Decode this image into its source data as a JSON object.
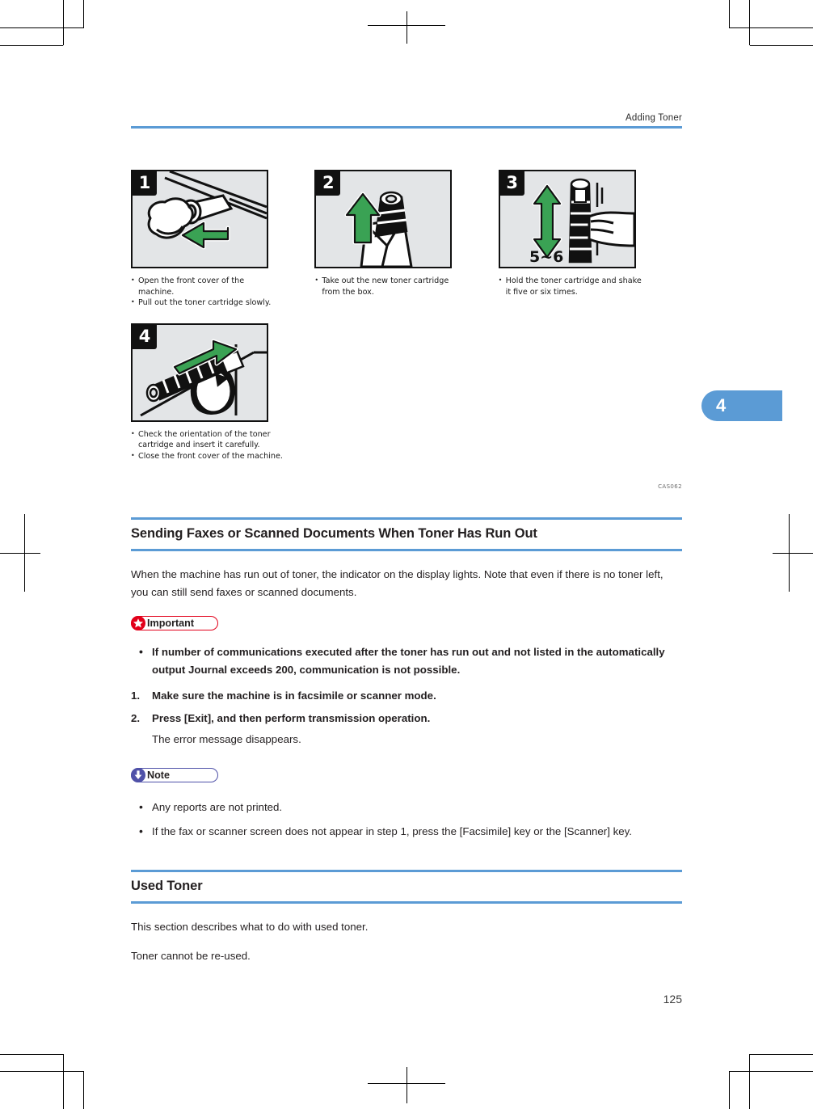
{
  "header": {
    "running_head": "Adding Toner",
    "rule_color": "#5b9bd5"
  },
  "chapter_tab": {
    "number": "4",
    "color": "#5b9bd5"
  },
  "figure": {
    "id_label": "CAS062",
    "steps": [
      {
        "number": "1",
        "alt": "hand pulling toner cartridge out of the machine",
        "captions": [
          "Open the front cover of the machine.",
          "Pull out the toner cartridge slowly."
        ]
      },
      {
        "number": "2",
        "alt": "new toner cartridge being taken out of the box",
        "captions": [
          "Take out the new toner cartridge from the box."
        ]
      },
      {
        "number": "3",
        "alt": "hand shaking toner cartridge up and down",
        "shake_label": "5~6",
        "captions": [
          "Hold the toner cartridge and shake it five or six times."
        ]
      },
      {
        "number": "4",
        "alt": "toner cartridge being inserted into the machine",
        "captions": [
          "Check the orientation of the toner cartridge and insert it carefully.",
          "Close the front cover of the machine."
        ]
      }
    ]
  },
  "sections": [
    {
      "heading": "Sending Faxes or Scanned Documents When Toner Has Run Out",
      "intro": "When the machine has run out of toner, the indicator on the display lights. Note that even if there is no toner left, you can still send faxes or scanned documents.",
      "important": {
        "label": "Important",
        "icon": "star-icon",
        "color": "#e2001a",
        "items": [
          "If number of communications executed after the toner has run out and not listed in the automatically output Journal exceeds 200, communication is not possible."
        ]
      },
      "steps": [
        {
          "number": "1.",
          "text": "Make sure the machine is in facsimile or scanner mode.",
          "sub": ""
        },
        {
          "number": "2.",
          "text": "Press [Exit], and then perform transmission operation.",
          "sub": "The error message disappears."
        }
      ],
      "note": {
        "label": "Note",
        "icon": "down-arrow-icon",
        "color": "#4f51a8",
        "items": [
          "Any reports are not printed.",
          "If the fax or scanner screen does not appear in step 1, press the [Facsimile] key or the [Scanner] key."
        ]
      }
    },
    {
      "heading": "Used Toner",
      "paragraphs": [
        "This section describes what to do with used toner.",
        "Toner cannot be re-used."
      ]
    }
  ],
  "folio": {
    "page_number": "125"
  }
}
